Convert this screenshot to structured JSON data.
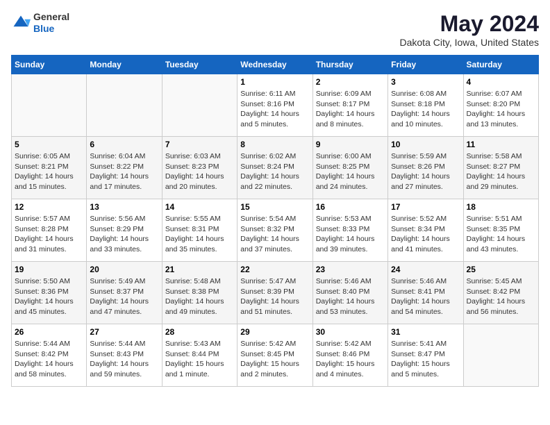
{
  "header": {
    "logo_line1": "General",
    "logo_line2": "Blue",
    "month": "May 2024",
    "location": "Dakota City, Iowa, United States"
  },
  "weekdays": [
    "Sunday",
    "Monday",
    "Tuesday",
    "Wednesday",
    "Thursday",
    "Friday",
    "Saturday"
  ],
  "weeks": [
    [
      {
        "day": "",
        "info": ""
      },
      {
        "day": "",
        "info": ""
      },
      {
        "day": "",
        "info": ""
      },
      {
        "day": "1",
        "info": "Sunrise: 6:11 AM\nSunset: 8:16 PM\nDaylight: 14 hours\nand 5 minutes."
      },
      {
        "day": "2",
        "info": "Sunrise: 6:09 AM\nSunset: 8:17 PM\nDaylight: 14 hours\nand 8 minutes."
      },
      {
        "day": "3",
        "info": "Sunrise: 6:08 AM\nSunset: 8:18 PM\nDaylight: 14 hours\nand 10 minutes."
      },
      {
        "day": "4",
        "info": "Sunrise: 6:07 AM\nSunset: 8:20 PM\nDaylight: 14 hours\nand 13 minutes."
      }
    ],
    [
      {
        "day": "5",
        "info": "Sunrise: 6:05 AM\nSunset: 8:21 PM\nDaylight: 14 hours\nand 15 minutes."
      },
      {
        "day": "6",
        "info": "Sunrise: 6:04 AM\nSunset: 8:22 PM\nDaylight: 14 hours\nand 17 minutes."
      },
      {
        "day": "7",
        "info": "Sunrise: 6:03 AM\nSunset: 8:23 PM\nDaylight: 14 hours\nand 20 minutes."
      },
      {
        "day": "8",
        "info": "Sunrise: 6:02 AM\nSunset: 8:24 PM\nDaylight: 14 hours\nand 22 minutes."
      },
      {
        "day": "9",
        "info": "Sunrise: 6:00 AM\nSunset: 8:25 PM\nDaylight: 14 hours\nand 24 minutes."
      },
      {
        "day": "10",
        "info": "Sunrise: 5:59 AM\nSunset: 8:26 PM\nDaylight: 14 hours\nand 27 minutes."
      },
      {
        "day": "11",
        "info": "Sunrise: 5:58 AM\nSunset: 8:27 PM\nDaylight: 14 hours\nand 29 minutes."
      }
    ],
    [
      {
        "day": "12",
        "info": "Sunrise: 5:57 AM\nSunset: 8:28 PM\nDaylight: 14 hours\nand 31 minutes."
      },
      {
        "day": "13",
        "info": "Sunrise: 5:56 AM\nSunset: 8:29 PM\nDaylight: 14 hours\nand 33 minutes."
      },
      {
        "day": "14",
        "info": "Sunrise: 5:55 AM\nSunset: 8:31 PM\nDaylight: 14 hours\nand 35 minutes."
      },
      {
        "day": "15",
        "info": "Sunrise: 5:54 AM\nSunset: 8:32 PM\nDaylight: 14 hours\nand 37 minutes."
      },
      {
        "day": "16",
        "info": "Sunrise: 5:53 AM\nSunset: 8:33 PM\nDaylight: 14 hours\nand 39 minutes."
      },
      {
        "day": "17",
        "info": "Sunrise: 5:52 AM\nSunset: 8:34 PM\nDaylight: 14 hours\nand 41 minutes."
      },
      {
        "day": "18",
        "info": "Sunrise: 5:51 AM\nSunset: 8:35 PM\nDaylight: 14 hours\nand 43 minutes."
      }
    ],
    [
      {
        "day": "19",
        "info": "Sunrise: 5:50 AM\nSunset: 8:36 PM\nDaylight: 14 hours\nand 45 minutes."
      },
      {
        "day": "20",
        "info": "Sunrise: 5:49 AM\nSunset: 8:37 PM\nDaylight: 14 hours\nand 47 minutes."
      },
      {
        "day": "21",
        "info": "Sunrise: 5:48 AM\nSunset: 8:38 PM\nDaylight: 14 hours\nand 49 minutes."
      },
      {
        "day": "22",
        "info": "Sunrise: 5:47 AM\nSunset: 8:39 PM\nDaylight: 14 hours\nand 51 minutes."
      },
      {
        "day": "23",
        "info": "Sunrise: 5:46 AM\nSunset: 8:40 PM\nDaylight: 14 hours\nand 53 minutes."
      },
      {
        "day": "24",
        "info": "Sunrise: 5:46 AM\nSunset: 8:41 PM\nDaylight: 14 hours\nand 54 minutes."
      },
      {
        "day": "25",
        "info": "Sunrise: 5:45 AM\nSunset: 8:42 PM\nDaylight: 14 hours\nand 56 minutes."
      }
    ],
    [
      {
        "day": "26",
        "info": "Sunrise: 5:44 AM\nSunset: 8:42 PM\nDaylight: 14 hours\nand 58 minutes."
      },
      {
        "day": "27",
        "info": "Sunrise: 5:44 AM\nSunset: 8:43 PM\nDaylight: 14 hours\nand 59 minutes."
      },
      {
        "day": "28",
        "info": "Sunrise: 5:43 AM\nSunset: 8:44 PM\nDaylight: 15 hours\nand 1 minute."
      },
      {
        "day": "29",
        "info": "Sunrise: 5:42 AM\nSunset: 8:45 PM\nDaylight: 15 hours\nand 2 minutes."
      },
      {
        "day": "30",
        "info": "Sunrise: 5:42 AM\nSunset: 8:46 PM\nDaylight: 15 hours\nand 4 minutes."
      },
      {
        "day": "31",
        "info": "Sunrise: 5:41 AM\nSunset: 8:47 PM\nDaylight: 15 hours\nand 5 minutes."
      },
      {
        "day": "",
        "info": ""
      }
    ]
  ]
}
